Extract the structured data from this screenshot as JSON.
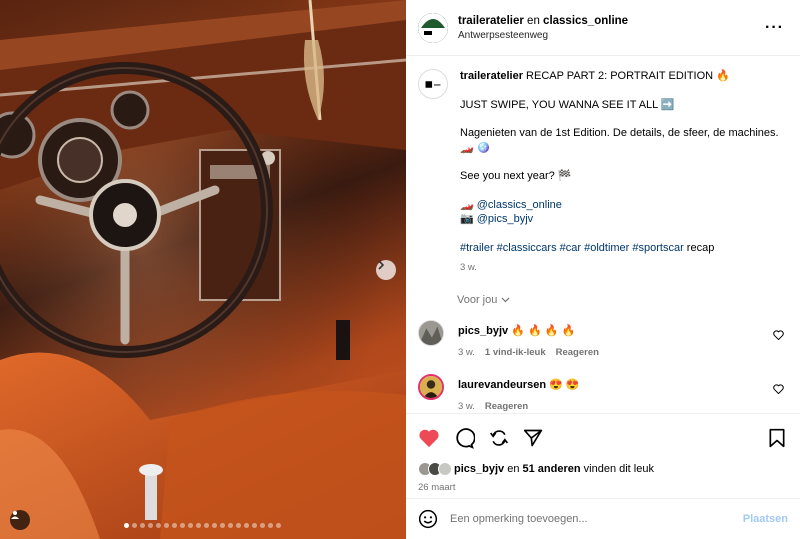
{
  "media": {
    "dots_total": 20,
    "active_dot": 0
  },
  "header": {
    "user1": "traileratelier",
    "connector": " en ",
    "user2": "classics_online",
    "location": "Antwerpsesteenweg",
    "more": "···"
  },
  "caption": {
    "username": "traileratelier",
    "line1": " RECAP PART 2: PORTRAIT EDITION 🔥",
    "line2": "JUST SWIPE, YOU WANNA SEE IT ALL ➡️",
    "line3": "Nagenieten van de 1st Edition. De details, de sfeer, de machines.",
    "line3_emoji": "🏎️ 🪩",
    "line4": "See you next year? 🏁",
    "mention1_prefix": "🏎️ ",
    "mention1": "@classics_online",
    "mention2_prefix": "📷 ",
    "mention2": "@pics_byjv",
    "hashtags": "#trailer #classiccars #car #oldtimer #sportscar",
    "hashtag_tail": " recap",
    "time": "3 w."
  },
  "see_translation": "Voor jou",
  "comments": [
    {
      "username": "pics_byjv",
      "text": " 🔥 🔥 🔥 🔥",
      "time": "3 w.",
      "likes": "1 vind-ik-leuk",
      "reply": "Reageren"
    },
    {
      "username": "laurevandeursen",
      "text": " 😍 😍",
      "time": "3 w.",
      "reply": "Reageren"
    }
  ],
  "likes": {
    "first_user": "pics_byjv",
    "connector": " en ",
    "others": "51 anderen",
    "suffix": " vinden dit leuk"
  },
  "date": "26 maart",
  "add_comment": {
    "placeholder": "Een opmerking toevoegen...",
    "post_label": "Plaatsen"
  },
  "colors": {
    "liked_heart": "#ed4956",
    "link": "#00376b",
    "post_button": "#a3c9f5"
  }
}
